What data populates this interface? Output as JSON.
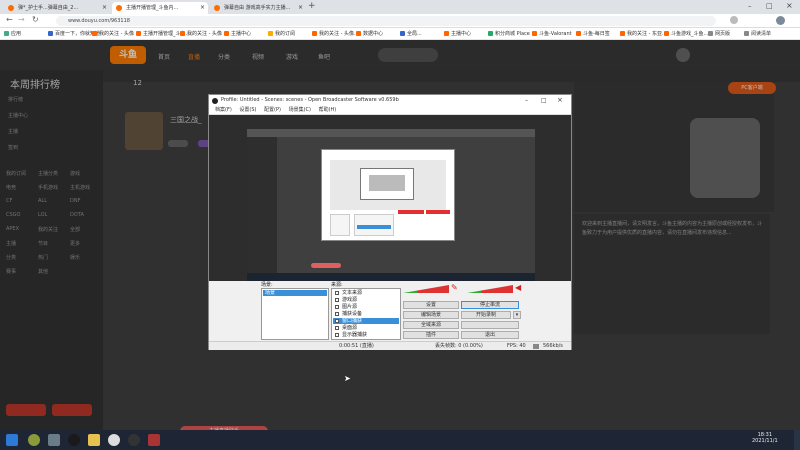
{
  "tabs": [
    {
      "label": "弹*_护士手...弹幕自由_2...",
      "color": "#ff6b00"
    },
    {
      "label": "主播开播管理_斗鱼内... ",
      "color": "#ff6b00"
    },
    {
      "label": "弹幕自由 游戏高手实力主播...",
      "color": "#ff6b00"
    }
  ],
  "address": {
    "url": "www.douyu.com/963118"
  },
  "bookmarks": [
    "应用",
    "百度一下，你就知道",
    "我的关注 - 头像",
    "主播开播管理_斗鱼...",
    "我的关注 - 头像",
    "主播中心",
    "我的订阅",
    "我的关注 - 头像...",
    "数据中心",
    "全局...",
    "主播中心",
    "积分商城 Place",
    "斗鱼-Valorant",
    "斗鱼-每日签",
    "我的关注 - 东亚...",
    "斗鱼游戏_斗鱼...",
    "网页版",
    "阅读清单"
  ],
  "site": {
    "logo": "斗鱼",
    "nav": [
      "首页",
      "直播",
      "分类",
      "视频",
      "游戏",
      "鱼吧"
    ],
    "ranking_title": "本周排行榜",
    "left_items": [
      "排行榜",
      "主播中心",
      "主播",
      "签到",
      "我的订阅",
      "主播分类",
      "游戏",
      "电竞",
      "手机游戏",
      "主机游戏",
      "CF",
      "ALL",
      "DNF",
      "CSGO",
      "LOL",
      "DOTA",
      "APEX",
      "我的关注",
      "全部",
      "主播",
      "节目",
      "更多",
      "分类",
      "热门",
      "娱乐",
      "赛事",
      "其他"
    ],
    "game_title": "三国之战_",
    "right_text": "欢迎来到主播直播间，请文明发言。斗鱼主播的内容为主播原创或经授权发布，斗鱼致力于为用户提供优质的直播内容，请勿在直播间发布违规信息...",
    "pc_button": "PC客户端",
    "stat": "12",
    "bottom_pill": "主播直播助手"
  },
  "obs": {
    "title": "Profile: Untitled - Scenes: scenes - Open Broadcaster Software v0.659b",
    "menu": [
      "档案(F)",
      "设置(S)",
      "配置(P)",
      "场景集(C)",
      "帮助(H)"
    ],
    "scenes_label": "场景:",
    "sources_label": "来源:",
    "scenes": [
      "场景"
    ],
    "sources": [
      "文本来源",
      "游戏源",
      "图片源",
      "捕获设备",
      "窗口捕获",
      "桌面源",
      "显示器捕获"
    ],
    "buttons": [
      "设置",
      "停止串流",
      "编辑场景",
      "开始录制",
      "全域来源",
      "插件",
      "退出"
    ],
    "status": {
      "time": "0:00:51 (直播)",
      "dropped": "丢失帧数: 0 (0.00%)",
      "fps": "FPS: 40",
      "bitrate": "566kb/s"
    }
  },
  "taskbar": {
    "time": "18:31",
    "date": "2021/11/1"
  }
}
